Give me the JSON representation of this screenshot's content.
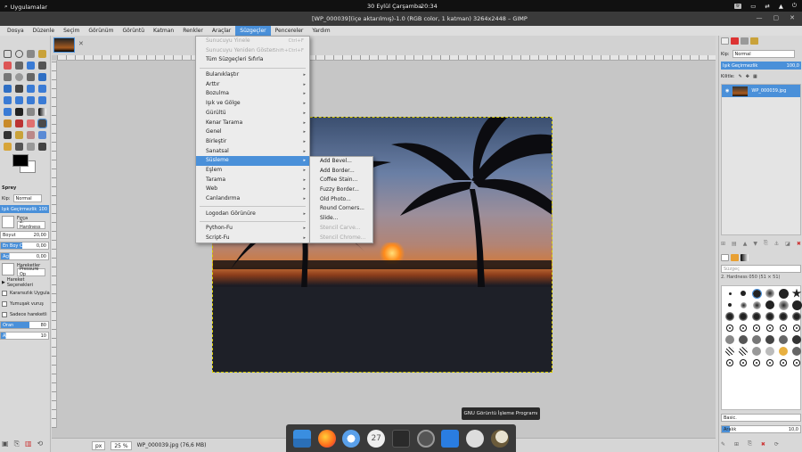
{
  "topbar": {
    "apps_label": "Uygulamalar",
    "date": "30 Eylül Çarşamba",
    "time": "20:34",
    "keyboard": "tr",
    "tray_icons": [
      "keyboard-icon",
      "display-icon",
      "network-icon",
      "notifications-icon",
      "power-icon"
    ]
  },
  "window": {
    "title": "[WP_000039](içe aktarılmış)-1.0 (RGB color, 1 katman) 3264x2448 – GIMP",
    "controls": [
      "—",
      "▢",
      "✕"
    ]
  },
  "menubar": {
    "items": [
      "Dosya",
      "Düzenle",
      "Seçim",
      "Görünüm",
      "Görüntü",
      "Katman",
      "Renkler",
      "Araçlar",
      "Süzgeçler",
      "Pencereler",
      "Yardım"
    ],
    "active": "Süzgeçler"
  },
  "filters_menu": {
    "top_items": [
      {
        "label": "Sunucuyu Yinele",
        "shortcut": "Ctrl+F",
        "disabled": true
      },
      {
        "label": "Sunucuyu Yeniden Göster",
        "shortcut": "Shift+Ctrl+F",
        "disabled": true
      },
      {
        "label": "Tüm Süzgeçleri Sıfırla",
        "shortcut": "",
        "disabled": false
      }
    ],
    "groups": [
      "Bulanıklaştır",
      "Arttır",
      "Bozulma",
      "Işık ve Gölge",
      "Gürültü",
      "Kenar Tarama",
      "Genel",
      "Birleştir",
      "Sanatsal",
      "Süsleme",
      "Eşlem",
      "Tarama",
      "Web",
      "Canlandırma"
    ],
    "highlighted": "Süsleme",
    "logo_item": "Logodan Görünüre",
    "script_items": [
      "Python-Fu",
      "Script-Fu"
    ]
  },
  "decor_submenu": {
    "items": [
      {
        "label": "Add Bevel...",
        "disabled": false
      },
      {
        "label": "Add Border...",
        "disabled": false
      },
      {
        "label": "Coffee Stain...",
        "disabled": false
      },
      {
        "label": "Fuzzy Border...",
        "disabled": false
      },
      {
        "label": "Old Photo...",
        "disabled": false
      },
      {
        "label": "Round Corners...",
        "disabled": false
      },
      {
        "label": "Slide...",
        "disabled": false
      },
      {
        "label": "Stencil Carve...",
        "disabled": true
      },
      {
        "label": "Stencil Chrome...",
        "disabled": true
      }
    ]
  },
  "tool_options": {
    "title": "Sprey",
    "mode_label": "Kip:",
    "mode_value": "Normal",
    "opacity_label": "Işık Geçirmezlik",
    "opacity_value": "100",
    "brush_label": "Fırça",
    "brush_value": "2. Hardness",
    "size_label": "Boyut",
    "size_value": "20,00",
    "aspect_label": "En Boy Or.",
    "aspect_value": "0,00",
    "angle_label": "Açı",
    "angle_value": "0,00",
    "dynamics_label": "Hareketler",
    "dynamics_value": "Pressure Op",
    "dynamics_options": "Hareket Seçenekleri",
    "check_items": [
      "Kararsızlık Uygula",
      "Yumuşak vuruş",
      "Sadece hareketli"
    ],
    "rate_label": "Oran",
    "rate_value": "80",
    "flow_label": "Akı",
    "flow_value": "10"
  },
  "status": {
    "unit": "px",
    "zoom": "25 %",
    "file_info": "WP_000039.jpg (76,6 MB)"
  },
  "layers_panel": {
    "mode_label": "Kip:",
    "mode_value": "Normal",
    "opacity_label": "Işık Geçirmezlik",
    "opacity_value": "100,0",
    "lock_label": "Kilitle:",
    "layer_name": "WP_000039.jpg"
  },
  "brushes_panel": {
    "filter_placeholder": "Süzgeç",
    "selected_brush": "2. Hardness 050 (51 × 51)",
    "preset": "Basic.",
    "spacing_label": "Aralık",
    "spacing_value": "10,0"
  },
  "tooltip": {
    "text": "GNU Görüntü İşleme Programı"
  },
  "dock": {
    "icons": [
      "workspace-icon",
      "firefox-icon",
      "files-icon",
      "calendar-icon",
      "terminal-icon",
      "settings-icon",
      "appstore-icon",
      "disk-icon",
      "gimp-icon"
    ],
    "calendar_day": "27"
  },
  "colors": {
    "accent": "#4a90d9",
    "topbar": "#111111",
    "titlebar": "#3a3a3a"
  }
}
